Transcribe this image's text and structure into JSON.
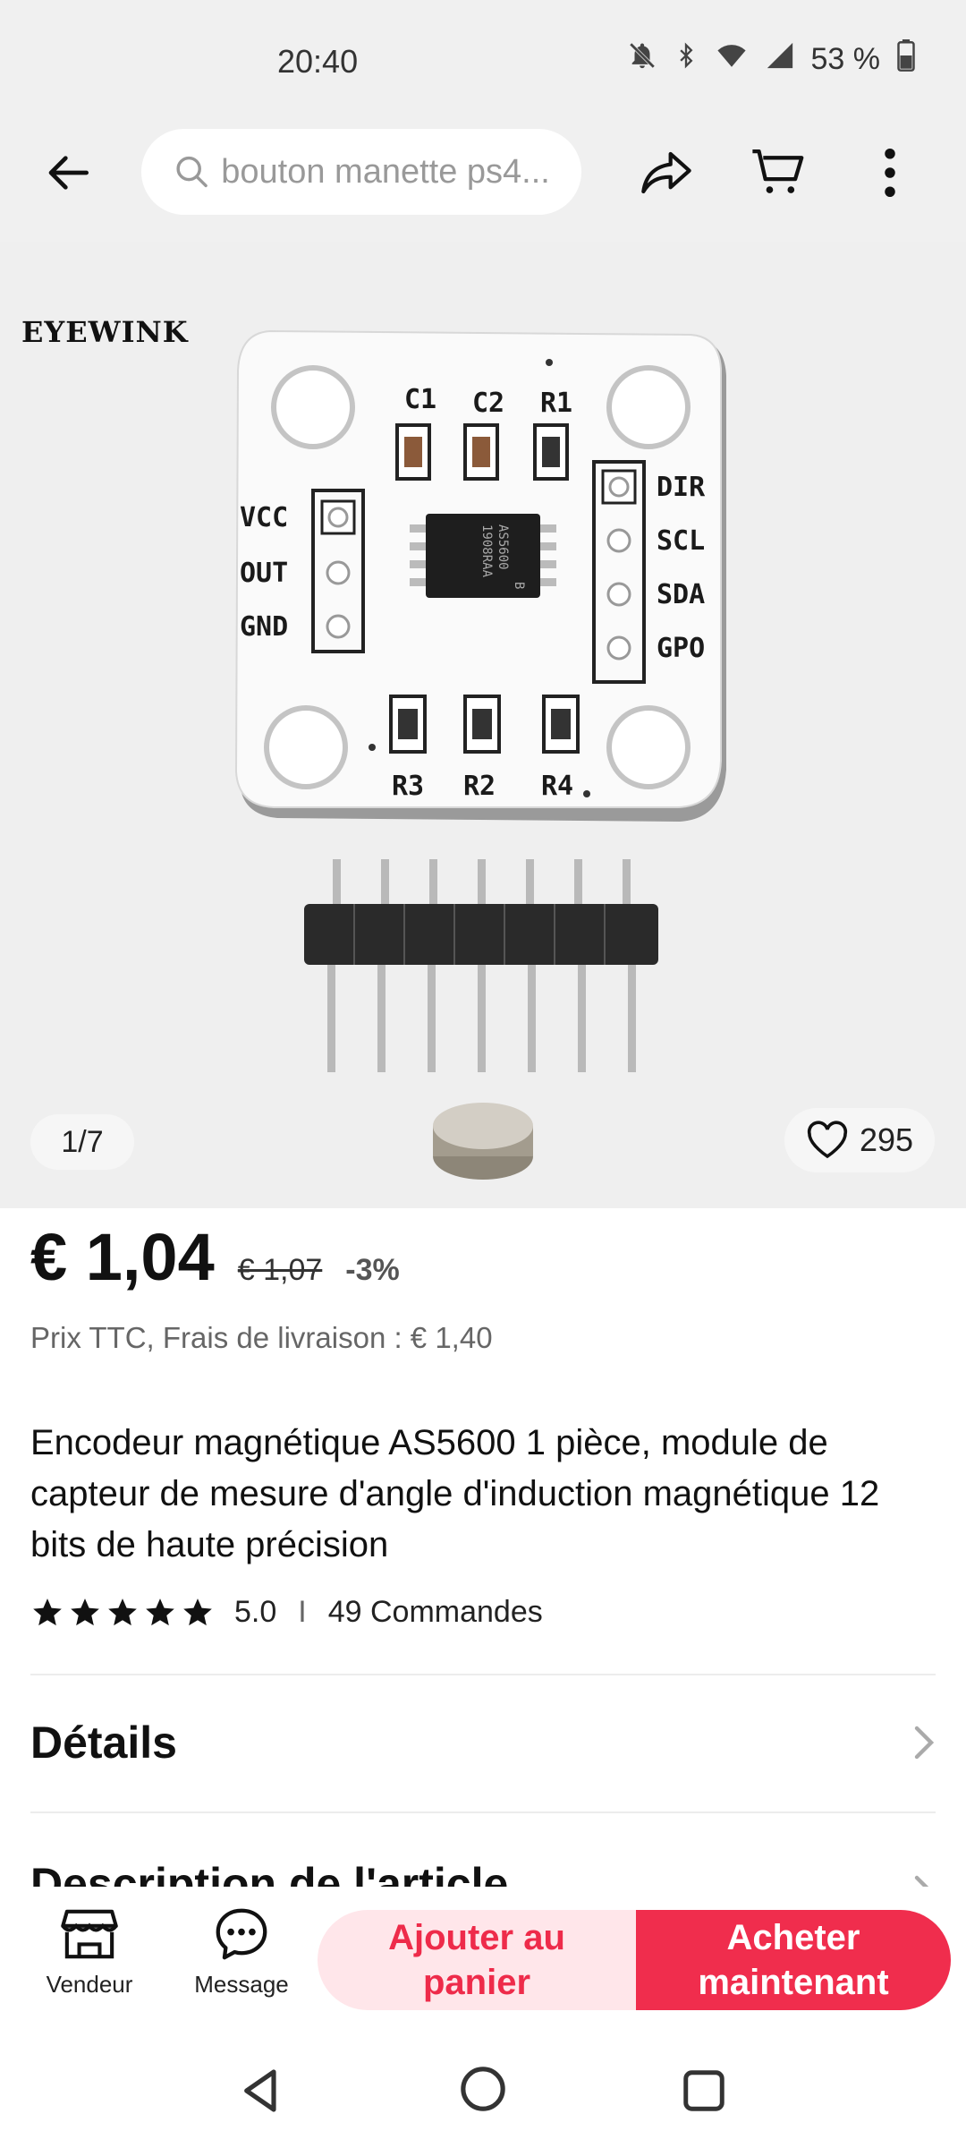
{
  "status_bar": {
    "time": "20:40",
    "battery": "53 %",
    "icons": [
      "notifications-off-icon",
      "bluetooth-icon",
      "wifi-icon",
      "signal-icon",
      "battery-icon"
    ]
  },
  "top_bar": {
    "search_text": "bouton manette ps4...",
    "icons": [
      "back-arrow-icon",
      "search-icon",
      "share-icon",
      "cart-icon",
      "more-vertical-icon"
    ]
  },
  "gallery": {
    "brand": "EYEWINK",
    "page_indicator": "1/7",
    "likes": "295",
    "pcb_labels": {
      "caps": [
        "C1",
        "C2",
        "R1"
      ],
      "left_pins": [
        "VCC",
        "OUT",
        "GND"
      ],
      "right_pins": [
        "DIR",
        "SCL",
        "SDA",
        "GPO"
      ],
      "bottom": [
        "R3",
        "R2",
        "R4"
      ],
      "chip": [
        "AS5600",
        "1908RAA",
        "B"
      ]
    }
  },
  "price": {
    "current": "€ 1,04",
    "original": "€ 1,07",
    "discount": "-3%",
    "tax_note": "Prix TTC, Frais de livraison : € 1,40"
  },
  "product": {
    "title": "Encodeur magnétique AS5600 1 pièce, module de capteur de mesure d'angle d'induction magnétique 12 bits de haute précision",
    "rating": "5.0",
    "stars": 5,
    "orders": "49 Commandes",
    "separator": "I"
  },
  "sections": {
    "details": "Détails",
    "description": "Description de l'article"
  },
  "bottom_bar": {
    "store_label": "Vendeur",
    "message_label": "Message",
    "add_cart_label": "Ajouter au panier",
    "buy_now_label": "Acheter maintenant"
  },
  "colors": {
    "accent": "#f02d4d",
    "accent_light": "#ffe6ea",
    "background_gray": "#efefef"
  }
}
